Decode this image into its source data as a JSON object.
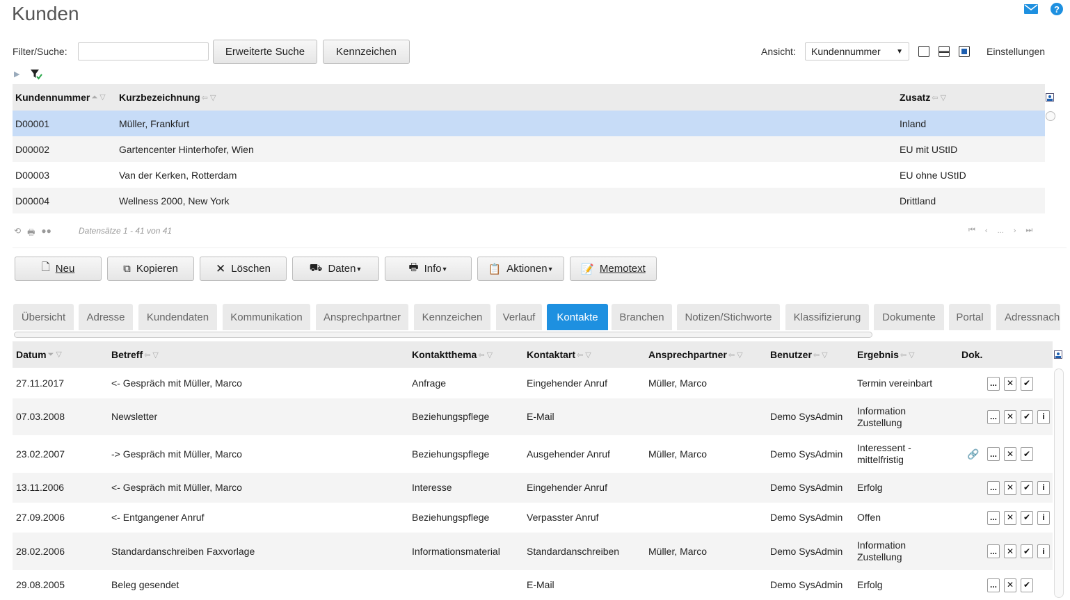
{
  "page": {
    "title": "Kunden",
    "mail_icon": "mail-icon",
    "help_icon": "help-icon"
  },
  "filter": {
    "label": "Filter/Suche:",
    "value": "",
    "search_btn": "Erweiterte Suche",
    "flags_btn": "Kennzeichen",
    "view_label": "Ansicht:",
    "view_value": "Kundennummer",
    "settings": "Einstellungen"
  },
  "customers": {
    "columns": [
      "Kundennummer",
      "Kurzbezeichnung",
      "Zusatz"
    ],
    "rows": [
      {
        "nr": "D00001",
        "name": "Müller, Frankfurt",
        "zusatz": "Inland"
      },
      {
        "nr": "D00002",
        "name": "Gartencenter Hinterhofer, Wien",
        "zusatz": "EU mit UStID"
      },
      {
        "nr": "D00003",
        "name": "Van der Kerken, Rotterdam",
        "zusatz": "EU ohne UStID"
      },
      {
        "nr": "D00004",
        "name": "Wellness 2000, New York",
        "zusatz": "Drittland"
      }
    ],
    "records": "Datensätze 1 - 41 von 41",
    "pager_ellipsis": "..."
  },
  "toolbar": {
    "new": "Neu",
    "copy": "Kopieren",
    "delete": "Löschen",
    "data": "Daten",
    "info": "Info",
    "actions": "Aktionen",
    "memo": "Memotext"
  },
  "tabs": [
    "Übersicht",
    "Adresse",
    "Kundendaten",
    "Kommunikation",
    "Ansprechpartner",
    "Kennzeichen",
    "Verlauf",
    "Kontakte",
    "Branchen",
    "Notizen/Stichworte",
    "Klassifizierung",
    "Dokumente",
    "Portal",
    "Adressnach"
  ],
  "contacts": {
    "columns": [
      "Datum",
      "Betreff",
      "Kontaktthema",
      "Kontaktart",
      "Ansprechpartner",
      "Benutzer",
      "Ergebnis",
      "Dok."
    ],
    "rows": [
      {
        "datum": "27.11.2017",
        "betreff": "<- Gespräch mit Müller, Marco",
        "thema": "Anfrage",
        "art": "Eingehender Anruf",
        "ap": "Müller, Marco",
        "benutzer": "",
        "erg1": "Termin vereinbart",
        "erg2": ""
      },
      {
        "datum": "07.03.2008",
        "betreff": "Newsletter",
        "thema": "Beziehungspflege",
        "art": "E-Mail",
        "ap": "",
        "benutzer": "Demo SysAdmin",
        "erg1": "Information",
        "erg2": "Zustellung"
      },
      {
        "datum": "23.02.2007",
        "betreff": "-> Gespräch mit Müller, Marco",
        "thema": "Beziehungspflege",
        "art": "Ausgehender Anruf",
        "ap": "Müller, Marco",
        "benutzer": "Demo SysAdmin",
        "erg1": "Interessent -",
        "erg2": "mittelfristig"
      },
      {
        "datum": "13.11.2006",
        "betreff": "<- Gespräch mit Müller, Marco",
        "thema": "Interesse",
        "art": "Eingehender Anruf",
        "ap": "",
        "benutzer": "Demo SysAdmin",
        "erg1": "Erfolg",
        "erg2": ""
      },
      {
        "datum": "27.09.2006",
        "betreff": "<- Entgangener Anruf",
        "thema": "Beziehungspflege",
        "art": "Verpasster Anruf",
        "ap": "",
        "benutzer": "Demo SysAdmin",
        "erg1": "Offen",
        "erg2": ""
      },
      {
        "datum": "28.02.2006",
        "betreff": "Standardanschreiben Faxvorlage",
        "thema": "Informationsmaterial",
        "art": "Standardanschreiben",
        "ap": "Müller, Marco",
        "benutzer": "Demo SysAdmin",
        "erg1": "Information",
        "erg2": "Zustellung"
      },
      {
        "datum": "29.08.2005",
        "betreff": "Beleg gesendet",
        "thema": "",
        "art": "E-Mail",
        "ap": "",
        "benutzer": "Demo SysAdmin",
        "erg1": "Erfolg",
        "erg2": ""
      }
    ],
    "btn_more": "...",
    "btn_info": "i"
  }
}
